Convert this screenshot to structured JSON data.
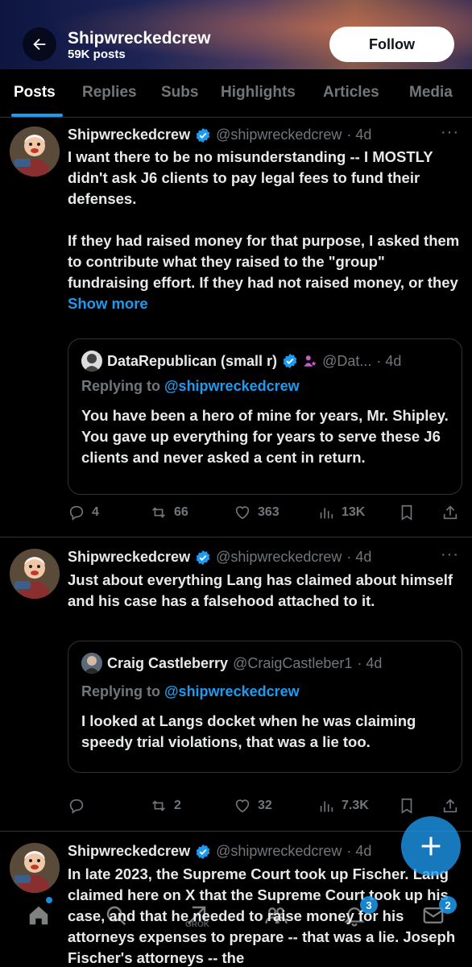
{
  "header": {
    "title": "Shipwreckedcrew",
    "subtitle": "59K posts",
    "follow_label": "Follow"
  },
  "tabs": [
    {
      "label": "Posts",
      "active": true
    },
    {
      "label": "Replies"
    },
    {
      "label": "Subs"
    },
    {
      "label": "Highlights"
    },
    {
      "label": "Articles"
    },
    {
      "label": "Media"
    }
  ],
  "posts": [
    {
      "author": "Shipwreckedcrew",
      "handle": "@shipwreckedcrew",
      "time": "· 4d",
      "text": "I want there to be no misunderstanding -- I MOSTLY didn't ask J6 clients to pay legal fees to fund their defenses.\n\nIf they had raised money for that purpose, I asked them to contribute what they raised to the \"group\" fundraising effort.  If they had not raised money, or they ",
      "show_more": "Show more",
      "quote": {
        "author": "DataRepublican (small r)",
        "handle": "@Dat...",
        "time": "· 4d",
        "replying_prefix": "Replying to ",
        "replying_to": "@shipwreckedcrew",
        "text": "You have been a hero of mine for years, Mr. Shipley. You gave up everything for years to serve these J6 clients and never asked a cent in return."
      },
      "stats": {
        "replies": "4",
        "reposts": "66",
        "likes": "363",
        "views": "13K"
      }
    },
    {
      "author": "Shipwreckedcrew",
      "handle": "@shipwreckedcrew",
      "time": "· 4d",
      "text": "Just about everything Lang has claimed about himself and his case has a falsehood attached to it.",
      "quote": {
        "author": "Craig Castleberry",
        "handle": "@CraigCastleber1",
        "time": "· 4d",
        "replying_prefix": "Replying to ",
        "replying_to": "@shipwreckedcrew",
        "text": "I looked at Langs docket when he was claiming speedy trial violations, that was a lie too."
      },
      "stats": {
        "replies": "",
        "reposts": "2",
        "likes": "32",
        "views": "7.3K"
      }
    },
    {
      "author": "Shipwreckedcrew",
      "handle": "@shipwreckedcrew",
      "time": "· 4d",
      "text": "In late 2023, the Supreme Court took up Fischer. Lang claimed here on X that the Supreme Court took up his case, and that he needed to raise money for his attorneys expenses to prepare -- that was a lie.  Joseph Fischer's attorneys -- the"
    }
  ],
  "bottom_nav": {
    "grok_label": "GROK",
    "notifications_badge": "3",
    "messages_badge": "2"
  }
}
